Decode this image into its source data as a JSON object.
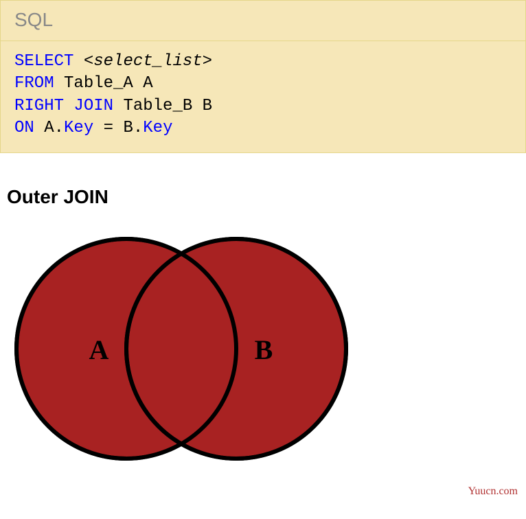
{
  "code": {
    "language_label": "SQL",
    "tokens": {
      "select": "SELECT",
      "placeholder": "<select_list>",
      "from": "FROM",
      "table_a": "Table_A A",
      "right_join": "RIGHT JOIN",
      "table_b": "Table_B B",
      "on": "ON",
      "a_ref": "A",
      "dot1": ".",
      "key1": "Key",
      "eq": " = ",
      "b_ref": "B",
      "dot2": ".",
      "key2": "Key"
    }
  },
  "heading": "Outer JOIN",
  "venn": {
    "label_a": "A",
    "label_b": "B"
  },
  "watermark": "Yuucn.com"
}
